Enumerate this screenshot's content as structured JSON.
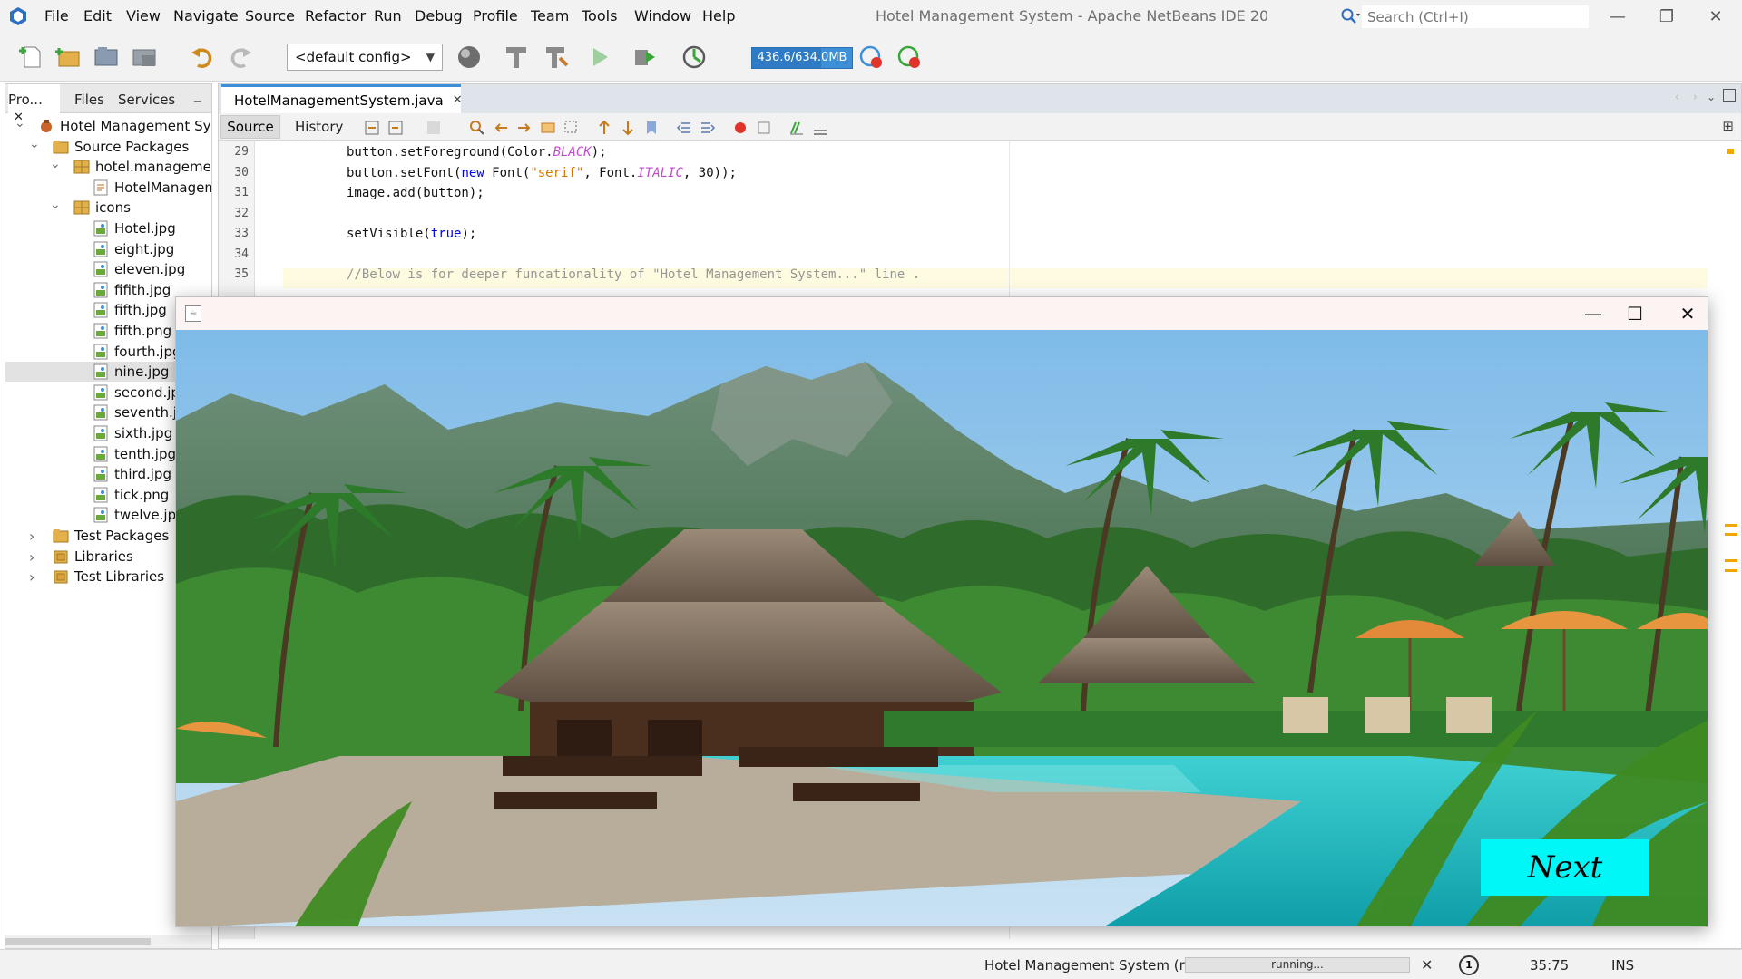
{
  "app": {
    "title": "Hotel Management System - Apache NetBeans IDE 20"
  },
  "menu": [
    "File",
    "Edit",
    "View",
    "Navigate",
    "Source",
    "Refactor",
    "Run",
    "Debug",
    "Profile",
    "Team",
    "Tools",
    "Window",
    "Help"
  ],
  "search": {
    "placeholder": "Search (Ctrl+I)"
  },
  "window_controls": {
    "minimize": "—",
    "maximize": "❐",
    "close": "✕"
  },
  "toolbar": {
    "config": "<default config>",
    "memory_label": "436.6/634.0MB",
    "memory_fraction": 0.69,
    "icons": [
      "new-file-icon",
      "new-project-icon",
      "open-project-icon",
      "close-project-icon",
      "undo-icon",
      "redo-icon",
      "globe-icon",
      "build-icon",
      "clean-build-icon",
      "run-icon",
      "debug-icon",
      "profile-icon",
      "gc-icon",
      "profiler-telemetry-icon"
    ]
  },
  "projects_panel": {
    "tabs": [
      "Pro...",
      "Files",
      "Services"
    ],
    "close_symbol": "✕",
    "minimize_symbol": "_",
    "tree": [
      {
        "label": "Hotel Management System",
        "level": 0,
        "icon": "project-icon",
        "expanded": true
      },
      {
        "label": "Source Packages",
        "level": 1,
        "icon": "folder-icon",
        "expanded": true
      },
      {
        "label": "hotel.management.system",
        "level": 2,
        "icon": "package-icon",
        "expanded": true
      },
      {
        "label": "HotelManagementSystem.java",
        "level": 3,
        "icon": "java-file-icon"
      },
      {
        "label": "icons",
        "level": 2,
        "icon": "package-icon",
        "expanded": true
      },
      {
        "label": "Hotel.jpg",
        "level": 3,
        "icon": "image-file-icon"
      },
      {
        "label": "eight.jpg",
        "level": 3,
        "icon": "image-file-icon"
      },
      {
        "label": "eleven.jpg",
        "level": 3,
        "icon": "image-file-icon"
      },
      {
        "label": "fifith.jpg",
        "level": 3,
        "icon": "image-file-icon"
      },
      {
        "label": "fifth.jpg",
        "level": 3,
        "icon": "image-file-icon"
      },
      {
        "label": "fifth.png",
        "level": 3,
        "icon": "image-file-icon"
      },
      {
        "label": "fourth.jpg",
        "level": 3,
        "icon": "image-file-icon"
      },
      {
        "label": "nine.jpg",
        "level": 3,
        "icon": "image-file-icon",
        "selected": true
      },
      {
        "label": "second.jpg",
        "level": 3,
        "icon": "image-file-icon"
      },
      {
        "label": "seventh.jpg",
        "level": 3,
        "icon": "image-file-icon"
      },
      {
        "label": "sixth.jpg",
        "level": 3,
        "icon": "image-file-icon"
      },
      {
        "label": "tenth.jpg",
        "level": 3,
        "icon": "image-file-icon"
      },
      {
        "label": "third.jpg",
        "level": 3,
        "icon": "image-file-icon"
      },
      {
        "label": "tick.png",
        "level": 3,
        "icon": "image-file-icon"
      },
      {
        "label": "twelve.jpg",
        "level": 3,
        "icon": "image-file-icon"
      },
      {
        "label": "Test Packages",
        "level": 1,
        "icon": "folder-icon",
        "expanded": false
      },
      {
        "label": "Libraries",
        "level": 1,
        "icon": "library-icon",
        "expanded": false
      },
      {
        "label": "Test Libraries",
        "level": 1,
        "icon": "library-icon",
        "expanded": false
      }
    ]
  },
  "editor": {
    "file_tab": "HotelManagementSystem.java",
    "source_tab": "Source",
    "history_tab": "History",
    "lines": [
      {
        "n": "29",
        "code": [
          [
            "",
            "button.setForeground(Color."
          ],
          [
            "itf",
            "BLACK"
          ],
          [
            "",
            ");"
          ]
        ]
      },
      {
        "n": "30",
        "code": [
          [
            "",
            "button.setFont("
          ],
          [
            "kw",
            "new"
          ],
          [
            "",
            " Font("
          ],
          [
            "str",
            "\"serif\""
          ],
          [
            "",
            ", Font."
          ],
          [
            "itf",
            "ITALIC"
          ],
          [
            "",
            ", 30));"
          ]
        ]
      },
      {
        "n": "31",
        "code": [
          [
            "",
            "image.add(button);"
          ]
        ]
      },
      {
        "n": "32",
        "code": []
      },
      {
        "n": "33",
        "code": [
          [
            "",
            "setVisible("
          ],
          [
            "kw",
            "true"
          ],
          [
            "",
            ");"
          ]
        ]
      },
      {
        "n": "34",
        "code": []
      },
      {
        "n": "35",
        "code": [
          [
            "cmt",
            "//Below is for deeper funcationality of \"Hotel Management System...\" line ."
          ]
        ]
      }
    ]
  },
  "status": {
    "run_label": "Hotel Management System (run)",
    "progress_text": "running...",
    "close_symbol": "✕",
    "notification_count": "1",
    "cursor_position": "35:75",
    "insert_mode": "INS"
  },
  "app_window": {
    "java_icon": "☕",
    "controls": {
      "minimize": "—",
      "maximize": "☐",
      "close": "✕"
    },
    "next_button": "Next",
    "next_color": "#00f7f7"
  },
  "colors": {
    "accent": "#3d8fd8",
    "pool": "#1fb3b3",
    "sky": "#8fc6ee"
  }
}
